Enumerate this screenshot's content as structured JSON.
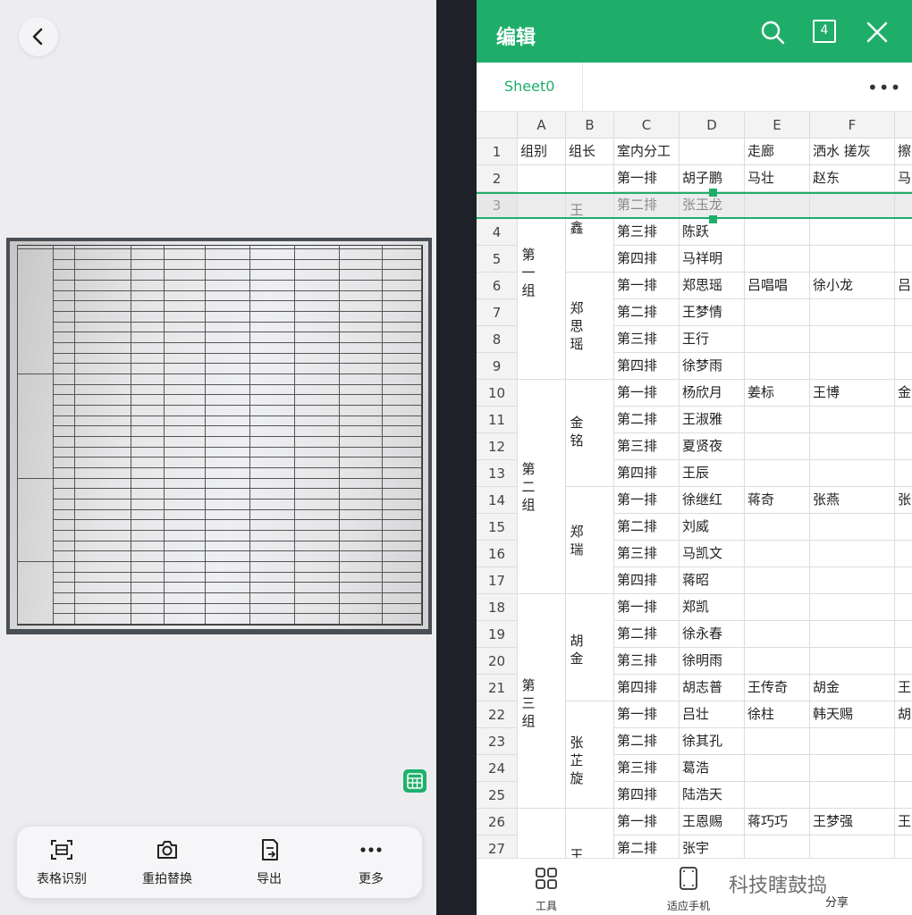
{
  "left_toolbar": {
    "items": [
      {
        "label": "表格识别",
        "icon": "scan-table-icon"
      },
      {
        "label": "重拍替换",
        "icon": "camera-icon"
      },
      {
        "label": "导出",
        "icon": "export-icon"
      },
      {
        "label": "更多",
        "icon": "more-icon"
      }
    ]
  },
  "header": {
    "title": "编辑",
    "page_count": "4"
  },
  "sheet": {
    "tab": "Sheet0",
    "more": "•••"
  },
  "columns": [
    "A",
    "B",
    "C",
    "D",
    "E",
    "F"
  ],
  "rows": [
    "1",
    "2",
    "3",
    "4",
    "5",
    "6",
    "7",
    "8",
    "9",
    "10",
    "11",
    "12",
    "13",
    "14",
    "15",
    "16",
    "17",
    "18",
    "19",
    "20",
    "21",
    "22",
    "23",
    "24",
    "25",
    "26",
    "27"
  ],
  "cells": {
    "r1": {
      "A": "组别",
      "B": "组长",
      "C": "室内分工",
      "E": "走廊",
      "F": "洒水 搓灰",
      "G": "擦"
    },
    "C_col": [
      "第一排",
      "第二排",
      "第三排",
      "第四排",
      "第一排",
      "第二排",
      "第三排",
      "第四排",
      "第一排",
      "第二排",
      "第三排",
      "第四排",
      "第一排",
      "第二排",
      "第三排",
      "第四排",
      "第一排",
      "第二排",
      "第三排",
      "第四排",
      "第一排",
      "第二排",
      "第三排",
      "第四排",
      "第一排",
      "第二排"
    ],
    "D_col": [
      "胡子鹏",
      "张玉龙",
      "陈跃",
      "马祥明",
      "郑思瑶",
      "王梦情",
      "王行",
      "徐梦雨",
      "杨欣月",
      "王淑雅",
      "夏贤夜",
      "王辰",
      "徐继红",
      "刘威",
      "马凯文",
      "蒋昭",
      "郑凯",
      "徐永春",
      "徐明雨",
      "胡志普",
      "吕壮",
      "徐其孔",
      "葛浩",
      "陆浩天",
      "王恩赐",
      "张宇"
    ],
    "E_r2": "马壮",
    "F_r2": "赵东",
    "G_r2": "马",
    "E_r6": "吕唱唱",
    "F_r6": "徐小龙",
    "G_r6": "吕",
    "E_r10": "姜标",
    "F_r10": "王博",
    "G_r10": "金",
    "E_r14": "蒋奇",
    "F_r14": "张燕",
    "G_r14": "张",
    "E_r21": "王传奇",
    "F_r21": "胡金",
    "G_r21": "王",
    "E_r22": "徐柱",
    "F_r22": "韩天赐",
    "G_r22": "胡",
    "E_r26": "蒋巧巧",
    "F_r26": "王梦强",
    "G_r26": "王",
    "groups": {
      "g1": "第一组",
      "g2": "第二组",
      "g3": "第三组"
    },
    "leaders": {
      "l1": "王鑫",
      "l2": "郑思瑶",
      "l3": "金铭",
      "l4": "郑瑞",
      "l5": "胡金",
      "l6": "张芷旋",
      "l7": "王"
    }
  },
  "bottom_bar": {
    "tools": "工具",
    "fit": "适应手机",
    "share": "分享",
    "watermark": "科技瞎鼓捣"
  },
  "colors": {
    "accent": "#1fae6a",
    "dark_bg": "#1f2129"
  }
}
